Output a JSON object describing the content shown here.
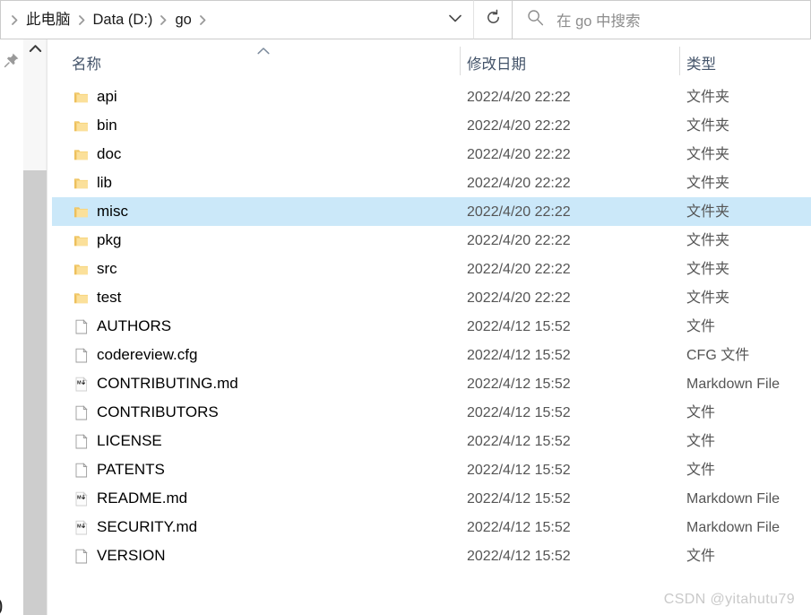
{
  "address": {
    "breadcrumbs": [
      {
        "label": "此电脑"
      },
      {
        "label": "Data (D:)"
      },
      {
        "label": "go"
      }
    ],
    "dropdown_icon": "chevron-down-icon",
    "refresh_icon": "refresh-icon"
  },
  "search": {
    "placeholder": "在 go 中搜索",
    "icon": "search-icon"
  },
  "rail": {
    "pin_icon": "pin-icon",
    "scroll_up_icon": "chevron-up-icon",
    "cut_glyph": ")"
  },
  "columns": {
    "name": "名称",
    "date": "修改日期",
    "type": "类型",
    "sort_indicator": "sort-ascending-caret"
  },
  "files": [
    {
      "name": "api",
      "date": "2022/4/20 22:22",
      "type": "文件夹",
      "icon": "folder-icon",
      "selected": false
    },
    {
      "name": "bin",
      "date": "2022/4/20 22:22",
      "type": "文件夹",
      "icon": "folder-icon",
      "selected": false
    },
    {
      "name": "doc",
      "date": "2022/4/20 22:22",
      "type": "文件夹",
      "icon": "folder-icon",
      "selected": false
    },
    {
      "name": "lib",
      "date": "2022/4/20 22:22",
      "type": "文件夹",
      "icon": "folder-icon",
      "selected": false
    },
    {
      "name": "misc",
      "date": "2022/4/20 22:22",
      "type": "文件夹",
      "icon": "folder-icon",
      "selected": true
    },
    {
      "name": "pkg",
      "date": "2022/4/20 22:22",
      "type": "文件夹",
      "icon": "folder-icon",
      "selected": false
    },
    {
      "name": "src",
      "date": "2022/4/20 22:22",
      "type": "文件夹",
      "icon": "folder-icon",
      "selected": false
    },
    {
      "name": "test",
      "date": "2022/4/20 22:22",
      "type": "文件夹",
      "icon": "folder-icon",
      "selected": false
    },
    {
      "name": "AUTHORS",
      "date": "2022/4/12 15:52",
      "type": "文件",
      "icon": "file-icon",
      "selected": false
    },
    {
      "name": "codereview.cfg",
      "date": "2022/4/12 15:52",
      "type": "CFG 文件",
      "icon": "file-icon",
      "selected": false
    },
    {
      "name": "CONTRIBUTING.md",
      "date": "2022/4/12 15:52",
      "type": "Markdown File",
      "icon": "markdown-icon",
      "selected": false
    },
    {
      "name": "CONTRIBUTORS",
      "date": "2022/4/12 15:52",
      "type": "文件",
      "icon": "file-icon",
      "selected": false
    },
    {
      "name": "LICENSE",
      "date": "2022/4/12 15:52",
      "type": "文件",
      "icon": "file-icon",
      "selected": false
    },
    {
      "name": "PATENTS",
      "date": "2022/4/12 15:52",
      "type": "文件",
      "icon": "file-icon",
      "selected": false
    },
    {
      "name": "README.md",
      "date": "2022/4/12 15:52",
      "type": "Markdown File",
      "icon": "markdown-icon",
      "selected": false
    },
    {
      "name": "SECURITY.md",
      "date": "2022/4/12 15:52",
      "type": "Markdown File",
      "icon": "markdown-icon",
      "selected": false
    },
    {
      "name": "VERSION",
      "date": "2022/4/12 15:52",
      "type": "文件",
      "icon": "file-icon",
      "selected": false
    }
  ],
  "watermark": "CSDN @yitahutu79",
  "colors": {
    "selection": "#cbe8f9",
    "folder": "#f5cf6b",
    "header_text": "#44546a"
  }
}
